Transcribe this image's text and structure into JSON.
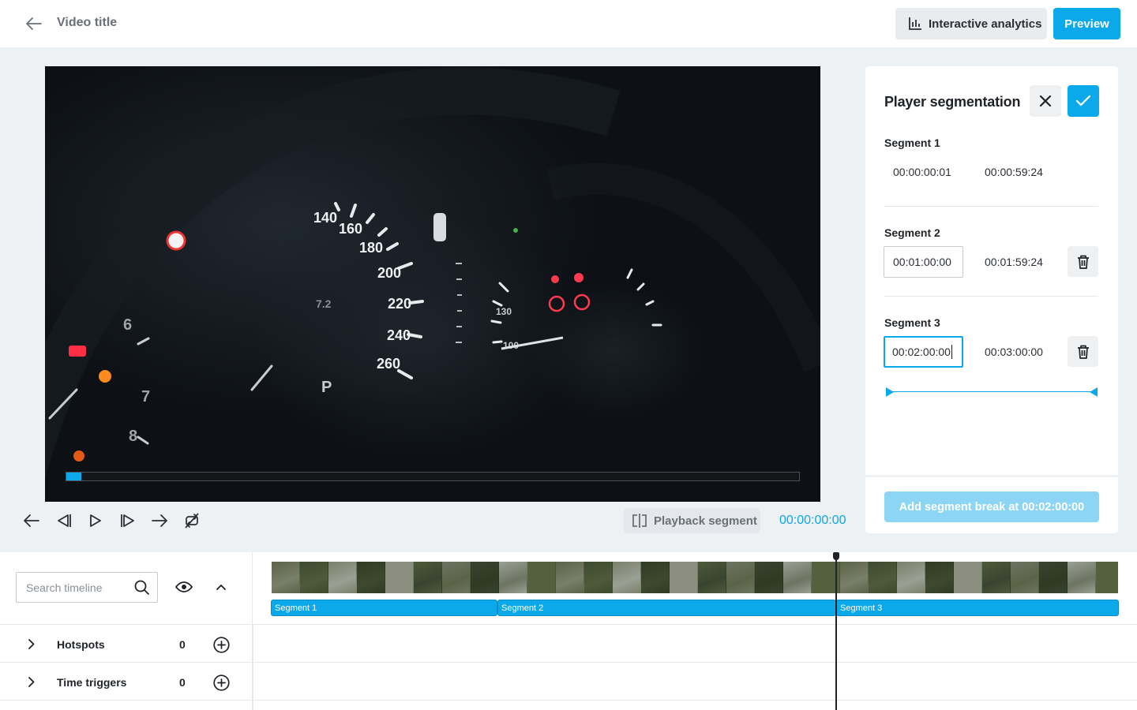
{
  "header": {
    "back_icon": "arrow-left-icon",
    "title": "Video title",
    "analytics_label": "Interactive analytics",
    "analytics_icon": "bar-chart-icon",
    "preview_label": "Preview"
  },
  "player": {
    "progress": 0.0,
    "playback_segment_label": "Playback segment",
    "current_time": "00:00:00:00",
    "controls": [
      "jump-back-icon",
      "step-back-icon",
      "play-icon",
      "step-forward-icon",
      "jump-forward-icon",
      "loop-off-icon"
    ]
  },
  "panel": {
    "title": "Player segmentation",
    "segments": [
      {
        "label": "Segment 1",
        "start": "00:00:00:01",
        "end": "00:00:59:24"
      },
      {
        "label": "Segment 2",
        "start": "00:01:00:00",
        "end": "00:01:59:24"
      },
      {
        "label": "Segment 3",
        "start": "00:02:00:00",
        "end": "00:03:00:00"
      }
    ],
    "add_break_label": "Add segment break at 00:02:00:00"
  },
  "timeline": {
    "search_placeholder": "Search timeline",
    "segment_bars": [
      "Segment 1",
      "Segment 2",
      "Segment 3"
    ],
    "rows": [
      {
        "label": "Hotspots",
        "count": "0"
      },
      {
        "label": "Time triggers",
        "count": "0"
      }
    ]
  },
  "colors": {
    "accent": "#0ba8ea",
    "accent_disabled": "#8dd5f5",
    "text_dark": "#1f2328",
    "text_muted": "#6b7078"
  }
}
